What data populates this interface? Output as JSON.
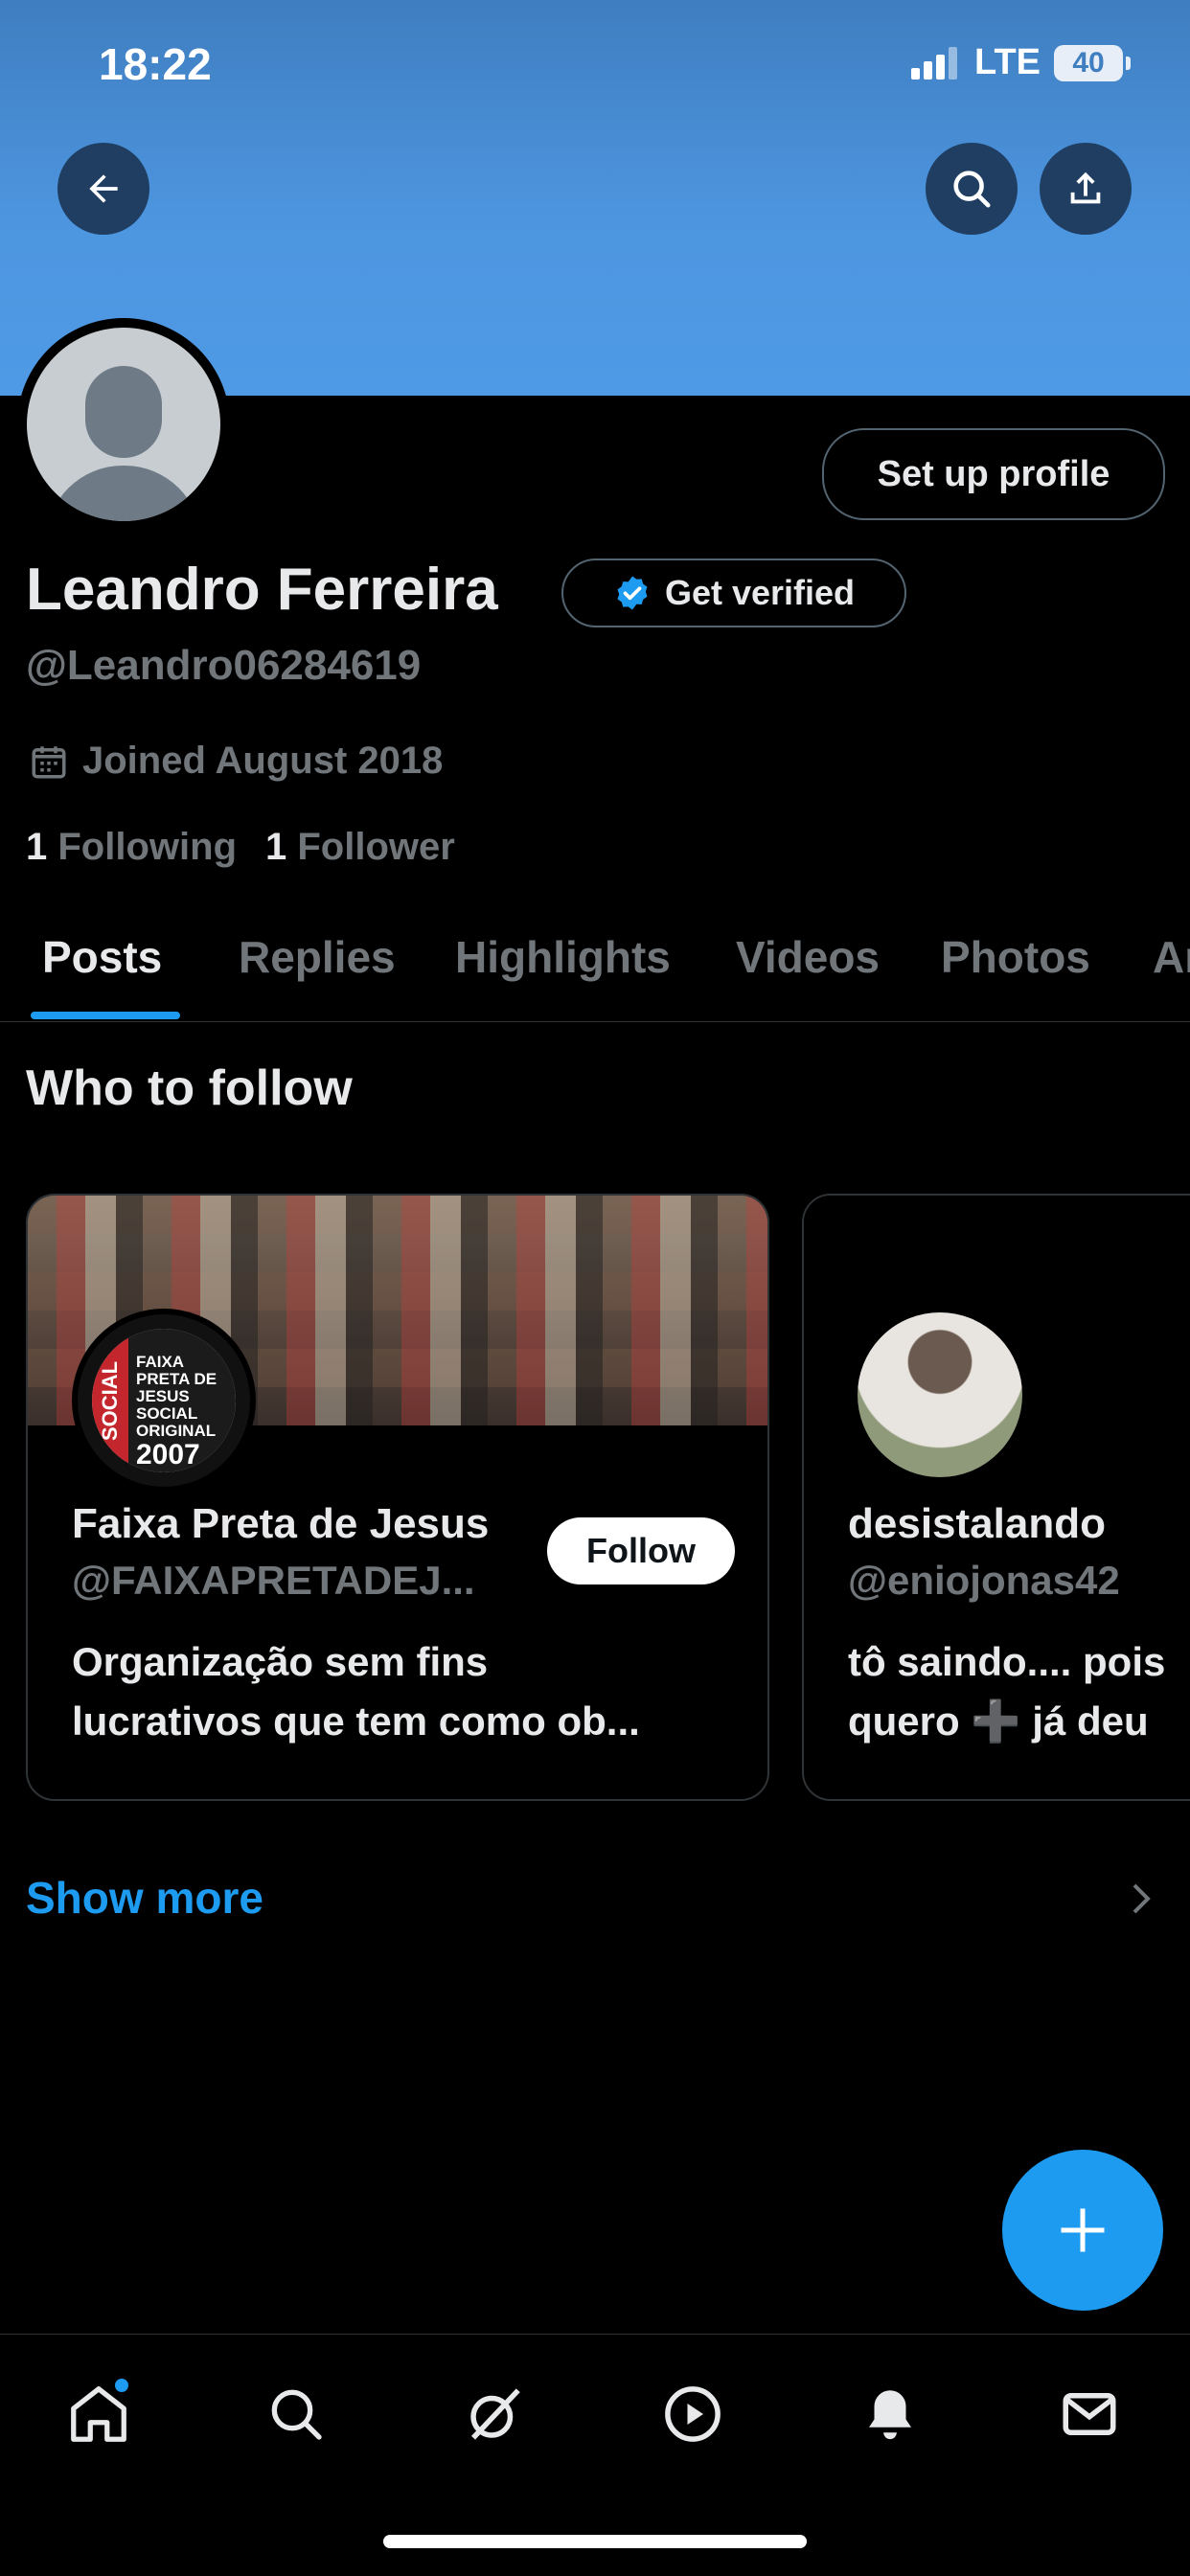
{
  "status_bar": {
    "time": "18:22",
    "network": "LTE",
    "battery": "40"
  },
  "header": {
    "back_icon": "arrow-left-icon",
    "search_icon": "search-icon",
    "share_icon": "share-icon",
    "banner_color": "#4d95df"
  },
  "profile": {
    "name": "Leandro Ferreira",
    "handle": "@Leandro06284619",
    "joined": "Joined August 2018",
    "following_count": "1",
    "following_label": "Following",
    "followers_count": "1",
    "followers_label": "Follower",
    "setup_button": "Set up profile",
    "verify_button": "Get verified"
  },
  "tabs": [
    {
      "label": "Posts",
      "active": true
    },
    {
      "label": "Replies",
      "active": false
    },
    {
      "label": "Highlights",
      "active": false
    },
    {
      "label": "Videos",
      "active": false
    },
    {
      "label": "Photos",
      "active": false
    },
    {
      "label": "Ar",
      "active": false
    }
  ],
  "who_to_follow": {
    "title": "Who to follow",
    "cards": [
      {
        "name": "Faixa Preta de Jesus",
        "handle": "@FAIXAPRETADEJ...",
        "bio_line1": "Organização sem fins",
        "bio_line2": "lucrativos que tem como ob...",
        "follow_label": "Follow",
        "logo_side_text": "SOCIAL",
        "logo_lines": [
          "FAIXA",
          "PRETA DE",
          "JESUS",
          "SOCIAL",
          "ORIGINAL"
        ],
        "logo_year": "2007"
      },
      {
        "name": "desistalando",
        "handle": "@eniojonas42",
        "bio_line1": "tô saindo.... pois",
        "bio_line2": "quero ➕ já deu"
      }
    ],
    "show_more": "Show more"
  },
  "fab": {
    "icon": "plus-icon"
  },
  "bottom_nav": [
    {
      "icon": "home-icon"
    },
    {
      "icon": "search-icon"
    },
    {
      "icon": "grok-icon"
    },
    {
      "icon": "play-icon"
    },
    {
      "icon": "bell-icon"
    },
    {
      "icon": "mail-icon"
    }
  ],
  "colors": {
    "accent": "#1d9bf0",
    "background": "#000000",
    "muted": "#71767b"
  }
}
